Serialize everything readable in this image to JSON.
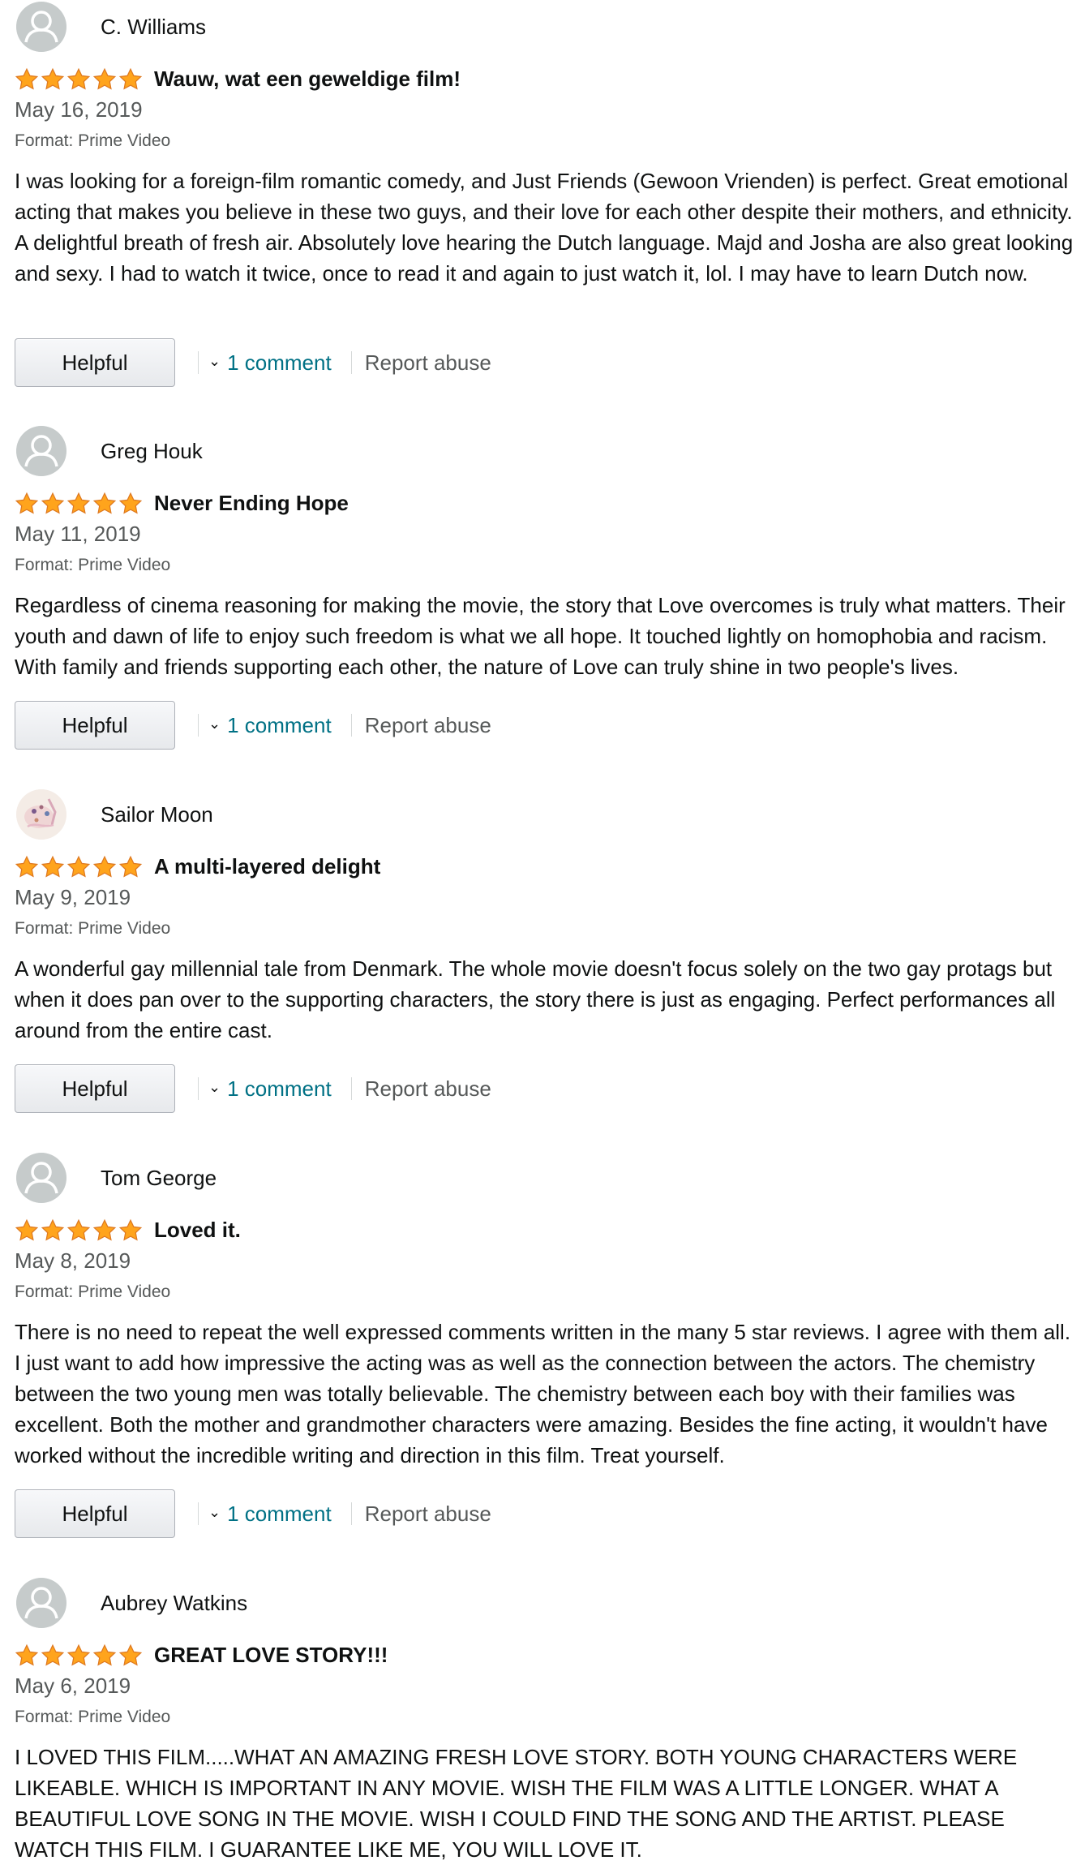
{
  "accent_color": "#007185",
  "star_color": "#ffa41c",
  "reviews": [
    {
      "name": "C. Williams",
      "avatar": "default-avatar-icon",
      "title": "Wauw, wat een geweldige film!",
      "rating": 5,
      "date": "May 16, 2019",
      "format": "Format: Prime Video",
      "body": "I was looking for a foreign-film romantic comedy, and Just Friends (Gewoon Vrienden) is perfect. Great emotional acting that makes you believe in these two guys, and their love for each other despite their mothers, and ethnicity. A delightful breath of fresh air. Absolutely love hearing the Dutch language. Majd and Josha are also great looking and sexy. I had to watch it twice, once to read it and again to just watch it, lol. I may have to learn Dutch now.",
      "helpful": "Helpful",
      "comments": "1 comment",
      "report": "Report abuse"
    },
    {
      "name": "Greg Houk",
      "avatar": "default-avatar-icon",
      "title": "Never Ending Hope",
      "rating": 5,
      "date": "May 11, 2019",
      "format": "Format: Prime Video",
      "body": "Regardless of cinema reasoning for making the movie, the story that Love overcomes is truly what matters. Their youth and dawn of life to enjoy such freedom is what we all hope. It touched lightly on homophobia and racism. With family and friends supporting each other, the nature of Love can truly shine in two people's lives.",
      "helpful": "Helpful",
      "comments": "1 comment",
      "report": "Report abuse"
    },
    {
      "name": "Sailor Moon",
      "avatar": "custom-avatar-icon",
      "title": "A multi-layered delight",
      "rating": 5,
      "date": "May 9, 2019",
      "format": "Format: Prime Video",
      "body": "A wonderful gay millennial tale from Denmark. The whole movie doesn't focus solely on the two gay protags but when it does pan over to the supporting characters, the story there is just as engaging. Perfect performances all around from the entire cast.",
      "helpful": "Helpful",
      "comments": "1 comment",
      "report": "Report abuse"
    },
    {
      "name": "Tom George",
      "avatar": "default-avatar-icon",
      "title": "Loved it.",
      "rating": 5,
      "date": "May 8, 2019",
      "format": "Format: Prime Video",
      "body": "There is no need to repeat the well expressed comments written in the many 5 star reviews. I agree with them all. I just want to add how impressive the acting was as well as the connection between the actors. The chemistry between the two young men was totally believable. The chemistry between each boy with their families was excellent. Both the mother and grandmother characters were amazing. Besides the fine acting, it wouldn't have worked without the incredible writing and direction in this film. Treat yourself.",
      "helpful": "Helpful",
      "comments": "1 comment",
      "report": "Report abuse"
    },
    {
      "name": "Aubrey Watkins",
      "avatar": "default-avatar-icon",
      "title": "GREAT LOVE STORY!!!",
      "rating": 5,
      "date": "May 6, 2019",
      "format": "Format: Prime Video",
      "body": "I LOVED THIS FILM.....WHAT AN AMAZING FRESH LOVE STORY. BOTH YOUNG CHARACTERS WERE LIKEABLE. WHICH IS IMPORTANT IN ANY MOVIE. WISH THE FILM WAS A LITTLE LONGER. WHAT A BEAUTIFUL LOVE SONG IN THE MOVIE. WISH I COULD FIND THE SONG AND THE ARTIST. PLEASE WATCH THIS FILM. I GUARANTEE LIKE ME, YOU WILL LOVE IT.",
      "helpful": null,
      "comments": null,
      "report": null
    }
  ]
}
